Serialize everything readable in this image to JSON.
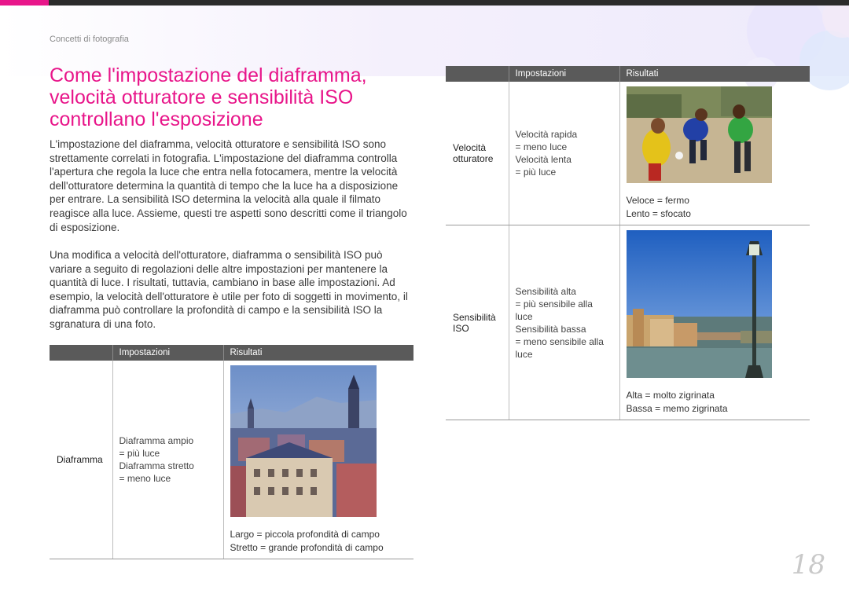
{
  "breadcrumb": "Concetti di fotografia",
  "heading": "Come l'impostazione del diaframma, velocità otturatore e sensibilità ISO controllano l'esposizione",
  "paragraphs": [
    "L'impostazione del diaframma, velocità otturatore e sensibilità ISO sono strettamente correlati in fotografia. L'impostazione del diaframma controlla l'apertura che regola la luce che entra nella fotocamera, mentre la velocità dell'otturatore determina la quantità di tempo che la luce ha a disposizione per entrare. La sensibilità ISO determina la velocità alla quale il filmato reagisce alla luce. Assieme, questi tre aspetti sono descritti come il triangolo di esposizione.",
    "Una modifica a velocità dell'otturatore, diaframma o sensibilità ISO può variare a seguito di regolazioni delle altre impostazioni per mantenere la quantità di luce.  I risultati, tuttavia, cambiano in base alle impostazioni. Ad esempio, la velocità dell'otturatore è utile per foto di soggetti in movimento, il diaframma può controllare la profondità di campo e la sensibilità ISO la sgranatura di una foto."
  ],
  "table_headers": {
    "settings": "Impostazioni",
    "results": "Risultati"
  },
  "aperture": {
    "label": "Diaframma",
    "settings": [
      "Diaframma ampio",
      "= più luce",
      "Diaframma stretto",
      "= meno luce"
    ],
    "results": [
      "Largo = piccola profondità di campo",
      "Stretto = grande profondità di campo"
    ],
    "photo_icon": "city-rooftops-photo"
  },
  "shutter": {
    "label_lines": [
      "Velocità",
      "otturatore"
    ],
    "settings": [
      "Velocità rapida",
      "= meno luce",
      "Velocità lenta",
      "= più luce"
    ],
    "results": [
      "Veloce = fermo",
      "Lento = sfocato"
    ],
    "photo_icon": "kids-football-photo"
  },
  "iso": {
    "label_lines": [
      "Sensibilità",
      "ISO"
    ],
    "settings": [
      "Sensibilità alta",
      "= più sensibile alla",
      "luce",
      "Sensibilità bassa",
      "= meno sensibile alla",
      "luce"
    ],
    "results": [
      "Alta = molto zigrinata",
      "Bassa = memo zigrinata"
    ],
    "photo_icon": "riverside-lamppost-photo"
  },
  "page_number": "18",
  "colors": {
    "accent": "#e8168a",
    "header_bar": "#5a5a5a",
    "top_bar": "#2b2b2b"
  }
}
